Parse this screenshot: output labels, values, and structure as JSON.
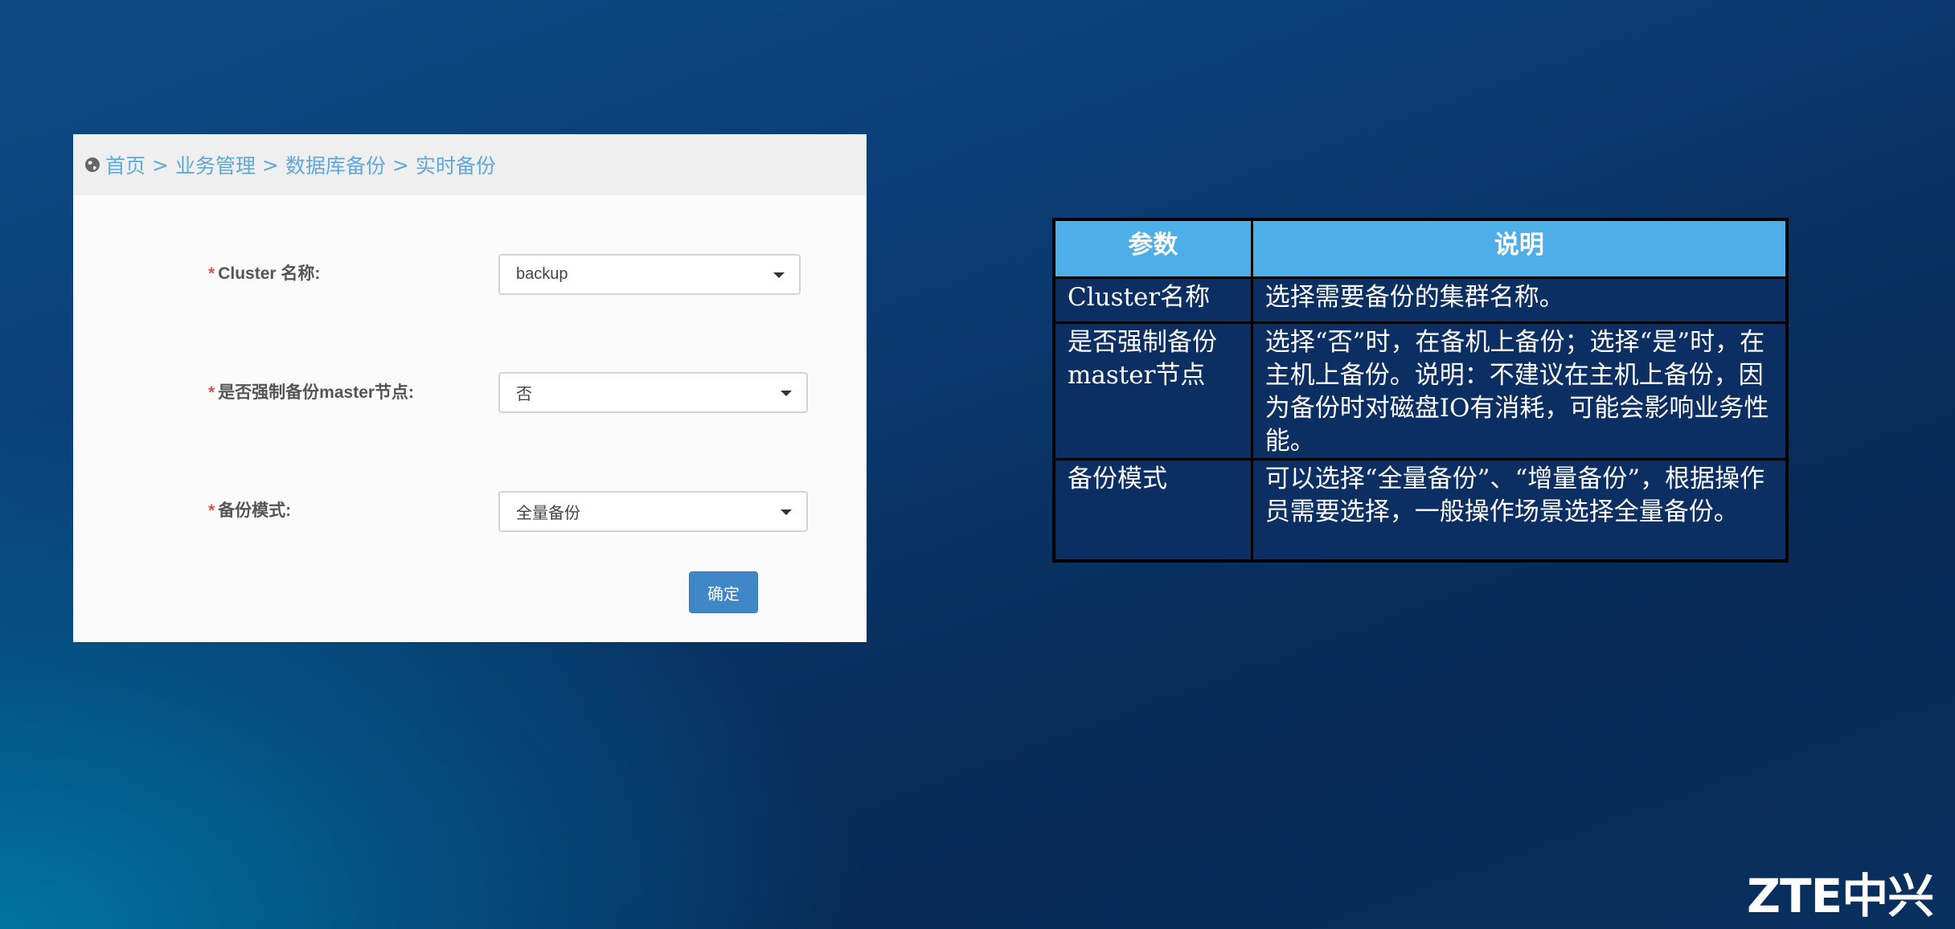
{
  "breadcrumb": {
    "items": [
      "首页",
      "业务管理",
      "数据库备份",
      "实时备份"
    ],
    "separator": ">"
  },
  "form": {
    "required_mark": "*",
    "fields": [
      {
        "label": "Cluster 名称:",
        "value": "backup"
      },
      {
        "label": "是否强制备份master节点:",
        "value": "否"
      },
      {
        "label": "备份模式:",
        "value": "全量备份"
      }
    ],
    "submit_label": "确定"
  },
  "param_table": {
    "headers": [
      "参数",
      "说明"
    ],
    "rows": [
      {
        "param": "Cluster名称",
        "desc": "选择需要备份的集群名称。"
      },
      {
        "param": "是否强制备份master节点",
        "desc": "选择“否”时，在备机上备份；选择“是”时，在主机上备份。说明：不建议在主机上备份，因为备份时对磁盘IO有消耗，可能会影响业务性能。"
      },
      {
        "param": "备份模式",
        "desc": "可以选择“全量备份”、“增量备份”，根据操作员需要选择，一般操作场景选择全量备份。"
      }
    ]
  },
  "logo": {
    "text": "ZTE中兴"
  },
  "colors": {
    "link": "#5fa8de",
    "required": "#d9534f",
    "button": "#3f87c6",
    "table_header": "#4daee8",
    "table_cell": "#0b2f63"
  },
  "icons": {
    "breadcrumb_home": "globe-icon",
    "select": "caret-down-icon"
  }
}
